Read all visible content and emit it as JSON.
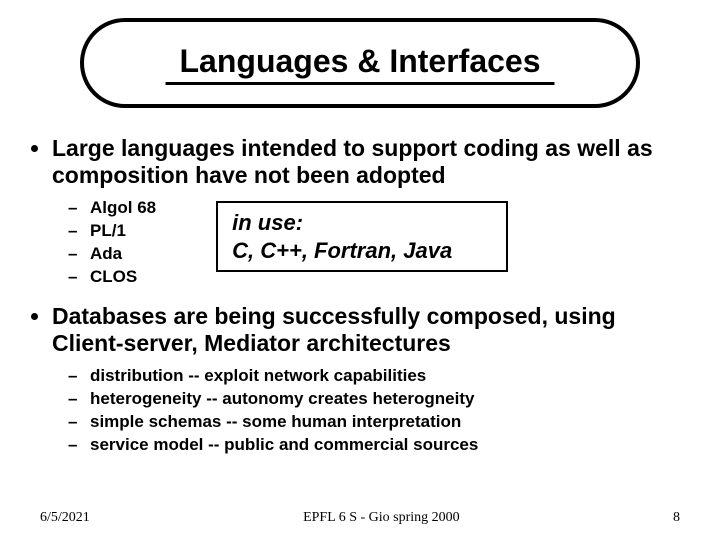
{
  "title": "Languages & Interfaces",
  "bullets": {
    "b1": "Large languages intended to support coding as well as composition have not been adopted",
    "b1_sub": {
      "s0": "Algol 68",
      "s1": "PL/1",
      "s2": "Ada",
      "s3": "CLOS"
    },
    "callout_line1": "in use:",
    "callout_line2": "C, C++, Fortran, Java",
    "b2": "Databases are being successfully composed, using Client-server, Mediator architectures",
    "b2_sub": {
      "s0": "distribution -- exploit network capabilities",
      "s1": "heterogeneity -- autonomy creates heterogneity",
      "s2": "simple schemas -- some human interpretation",
      "s3": "service model -- public and commercial sources"
    }
  },
  "footer": {
    "date": "6/5/2021",
    "center": "EPFL 6 S -  Gio spring 2000",
    "page": "8"
  }
}
